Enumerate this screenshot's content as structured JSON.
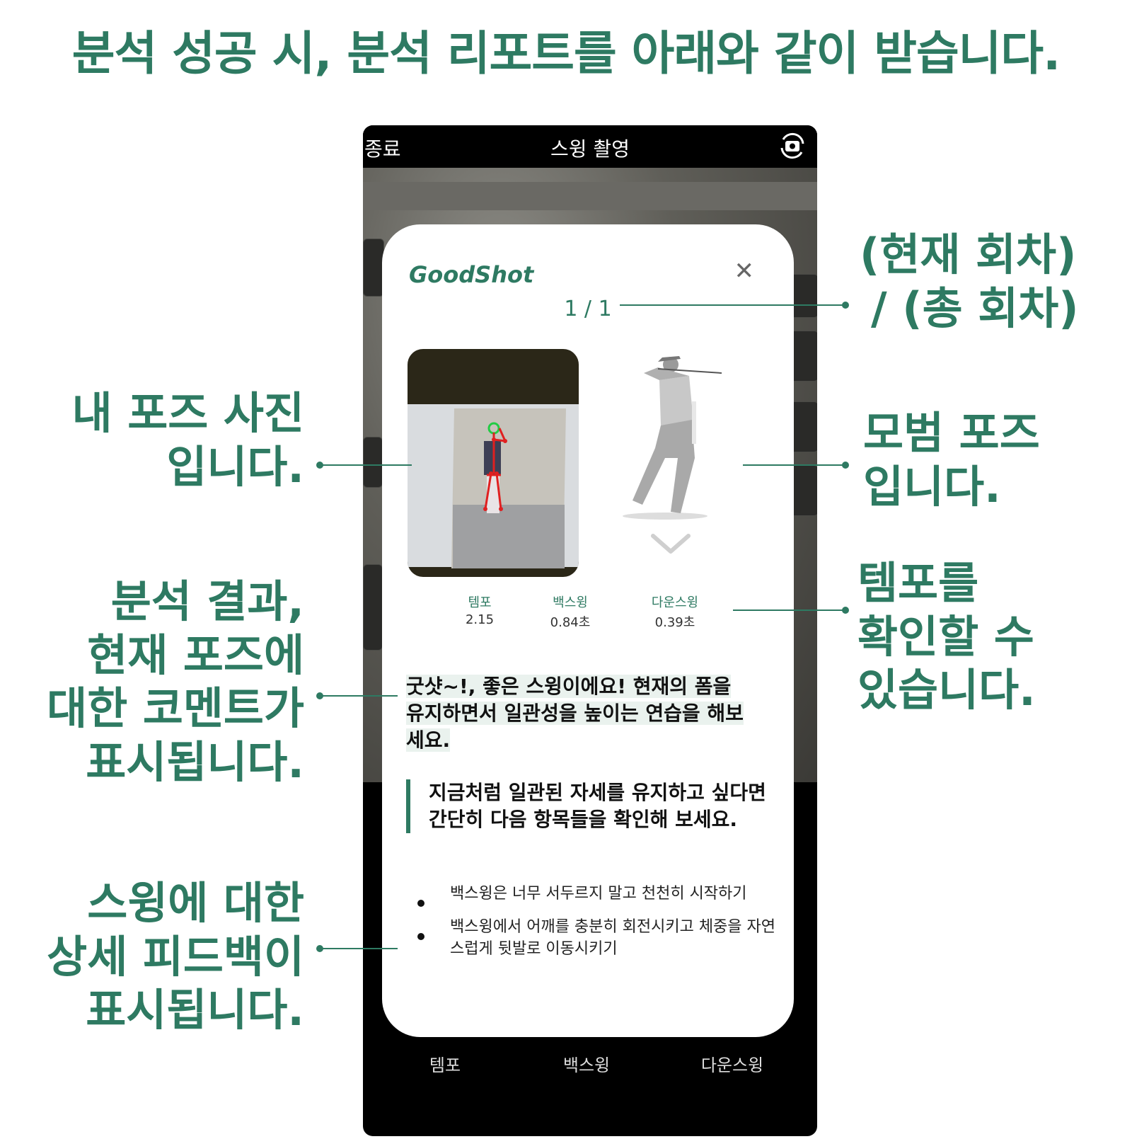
{
  "headline": "분석 성공 시, 분석 리포트를 아래와 같이 받습니다.",
  "annotations": {
    "counter_label": [
      "(현재 회차)",
      "/ (총 회차)"
    ],
    "my_pose": [
      "내 포즈 사진",
      "입니다."
    ],
    "model_pose": [
      "모범 포즈",
      "입니다."
    ],
    "tempo": [
      "템포를",
      "확인할 수",
      "있습니다."
    ],
    "comment": [
      "분석 결과,",
      "현재 포즈에",
      "대한 코멘트가",
      "표시됩니다."
    ],
    "feedback": [
      "스윙에 대한",
      "상세 피드백이",
      "표시됩니다."
    ]
  },
  "phone": {
    "top_bar": {
      "left_label": "종료",
      "title": "스윙 촬영",
      "right_icon": "camera-rotate-icon"
    },
    "card": {
      "brand": "GoodShot",
      "close_icon": "close-icon",
      "counter": "1 / 1",
      "stats": [
        {
          "label": "템포",
          "value": "2.15"
        },
        {
          "label": "백스윙",
          "value": "0.84초"
        },
        {
          "label": "다운스윙",
          "value": "0.39초"
        }
      ],
      "comment": "굿샷~!, 좋은 스윙이에요! 현재의 폼을 유지하면서 일관성을 높이는 연습을 해보세요.",
      "quote": "지금처럼 일관된 자세를 유지하고 싶다면 간단히 다음 항목들을 확인해 보세요.",
      "bullets": [
        "백스윙은 너무 서두르지 말고 천천히 시작하기",
        "백스윙에서 어깨를 충분히 회전시키고 체중을 자연스럽게 뒷발로 이동시키기"
      ]
    },
    "bottom_tabs": [
      "템포",
      "백스윙",
      "다운스윙"
    ]
  },
  "colors": {
    "accent": "#2e7a62",
    "pose_skeleton": "#e02020",
    "pose_head": "#22cc44"
  }
}
